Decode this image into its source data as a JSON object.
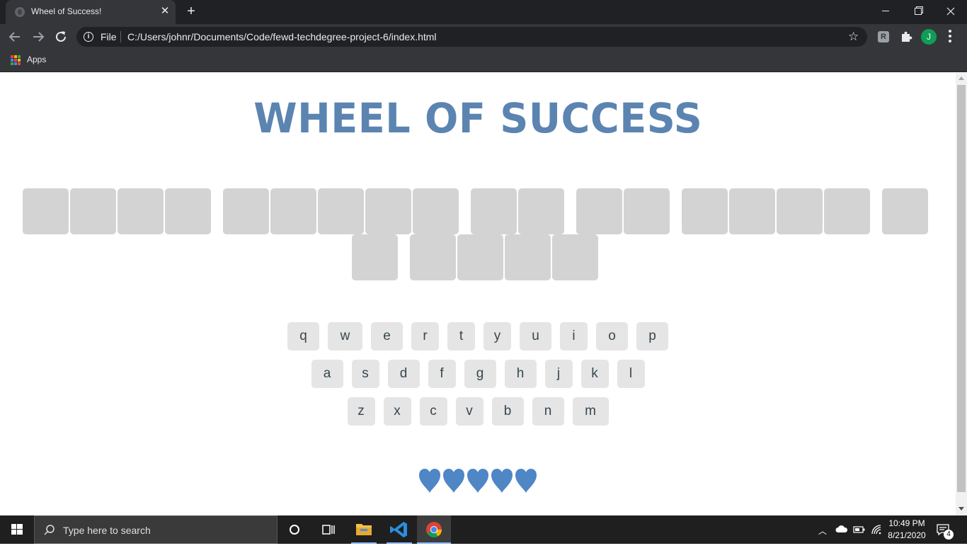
{
  "browser": {
    "tab_title": "Wheel of Success!",
    "new_tab_symbol": "+",
    "url_scheme": "File",
    "url": "C:/Users/johnr/Documents/Code/fewd-techdegree-project-6/index.html",
    "profile_initial": "J",
    "extension_letter": "R",
    "bookmarks": {
      "apps_label": "Apps"
    }
  },
  "page": {
    "title": "WHEEL OF SUCCESS",
    "phrase": {
      "word_lengths_row1": [
        4,
        5,
        2,
        2,
        4,
        1
      ],
      "word_lengths_row2": [
        1,
        4
      ],
      "hidden_letter_count": 23
    },
    "keyboard": {
      "rows": [
        [
          "q",
          "w",
          "e",
          "r",
          "t",
          "y",
          "u",
          "i",
          "o",
          "p"
        ],
        [
          "a",
          "s",
          "d",
          "f",
          "g",
          "h",
          "j",
          "k",
          "l"
        ],
        [
          "z",
          "x",
          "c",
          "v",
          "b",
          "n",
          "m"
        ]
      ]
    },
    "lives": {
      "remaining": 5,
      "total": 5
    },
    "colors": {
      "title": "#5b84b1",
      "heart": "#4f86c6",
      "letter_box": "#d3d3d3",
      "key": "#e5e5e5"
    }
  },
  "taskbar": {
    "search_placeholder": "Type here to search",
    "time": "10:49 PM",
    "date": "8/21/2020",
    "notification_count": "4"
  }
}
